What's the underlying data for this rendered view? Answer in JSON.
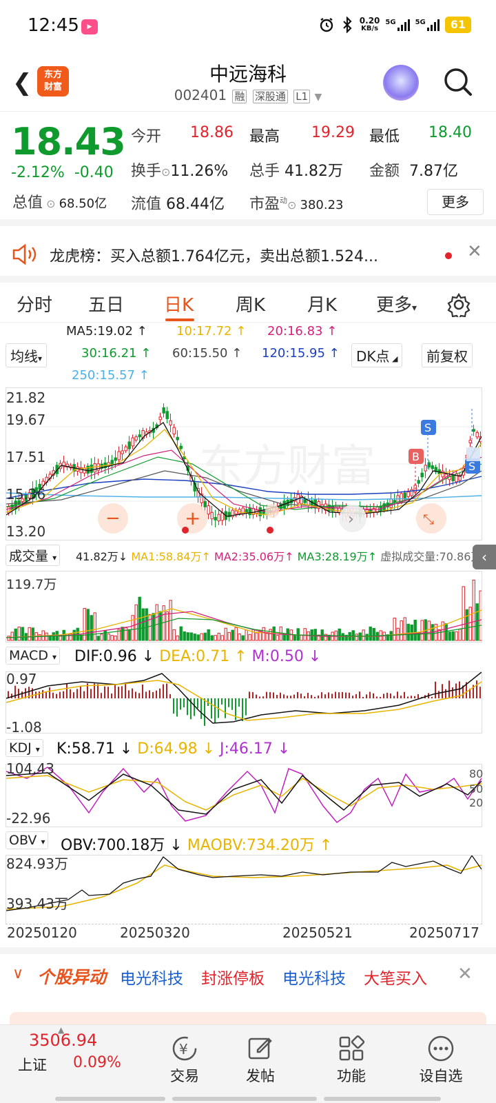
{
  "status_bar": {
    "time": "12:45",
    "app_icon": "bilibili-icon",
    "net_speed": "0.20",
    "net_unit": "KB/s",
    "sim1": "5G",
    "sim2": "5G",
    "battery": "61"
  },
  "header": {
    "logo_line1": "东方",
    "logo_line2": "财富",
    "title": "中远海科",
    "code": "002401",
    "tags": [
      "融",
      "深股通",
      "L1"
    ]
  },
  "quote": {
    "price": "18.43",
    "change_pct": "-2.12%",
    "change_amt": "-0.40",
    "open_label": "今开",
    "open": "18.86",
    "high_label": "最高",
    "high": "19.29",
    "low_label": "最低",
    "low": "18.40",
    "turnover_label": "换手",
    "turnover": "11.26%",
    "volume_label": "总手",
    "volume": "41.82万",
    "amount_label": "金额",
    "amount": "7.87亿",
    "mcap_label": "总值",
    "mcap": "68.50亿",
    "float_label": "流值",
    "float_cap": "68.44亿",
    "pe_label": "市盈",
    "pe_sup": "动",
    "pe": "380.23",
    "more": "更多"
  },
  "news": {
    "text": "龙虎榜：买入总额1.764亿元，卖出总额1.524..."
  },
  "tabs": [
    "分时",
    "五日",
    "日K",
    "周K",
    "月K",
    "更多"
  ],
  "active_tab": 2,
  "ma_legend": {
    "ma5": "MA5:19.02 ↑",
    "ma10": "10:17.72 ↑",
    "ma20": "20:16.83 ↑",
    "ma30": "30:16.21 ↑",
    "ma60": "60:15.50 ↑",
    "ma120": "120:15.95 ↑",
    "ma250": "250:15.57 ↑",
    "junxian": "均线",
    "dk": "DK点",
    "fq": "前复权"
  },
  "kline": {
    "y_labels": [
      "21.82",
      "19.67",
      "17.51",
      "15.36",
      "13.20"
    ],
    "watermark": "东方财富",
    "marker_b": "B",
    "marker_s": "S"
  },
  "volume": {
    "label": "成交量",
    "vol": "41.82万↓",
    "ma1": "MA1:58.84万↑",
    "ma2": "MA2:35.06万↑",
    "ma3": "MA3:28.19万↑",
    "virtual": "虚拟成交量:70.86万",
    "y_top": "119.7万"
  },
  "macd": {
    "label": "MACD",
    "dif": "DIF:0.96 ↓",
    "dea": "DEA:0.71 ↑",
    "m": "M:0.50 ↓",
    "y_top": "0.97",
    "y_bottom": "-1.08"
  },
  "kdj": {
    "label": "KDJ",
    "k": "K:58.71 ↓",
    "d": "D:64.98 ↓",
    "j": "J:46.17 ↓",
    "y_top": "104.43",
    "y_bottom": "-22.96",
    "r80": "80",
    "r50": "50",
    "r20": "20"
  },
  "obv": {
    "label": "OBV",
    "obv": "OBV:700.18万 ↓",
    "maobv": "MAOBV:734.20万 ↑",
    "y_top": "824.93万",
    "y_bottom": "393.43万"
  },
  "dates": [
    "20250120",
    "20250320",
    "20250521",
    "20250717"
  ],
  "alert": {
    "title": "个股异动",
    "items": [
      "电光科技",
      "封涨停板",
      "电光科技",
      "大笔买入"
    ]
  },
  "bottom_nav": {
    "index_value": "3506.94",
    "index_name": "上证",
    "index_pct": "0.09%",
    "items": [
      "交易",
      "发帖",
      "功能",
      "设自选"
    ]
  },
  "colors": {
    "up": "#e0242b",
    "down": "#0e9a2c",
    "accent": "#e8541e",
    "ma10": "#e8b400",
    "ma20": "#d4207a",
    "ma120": "#1a3fbf",
    "ma250": "#4ab0e8"
  }
}
